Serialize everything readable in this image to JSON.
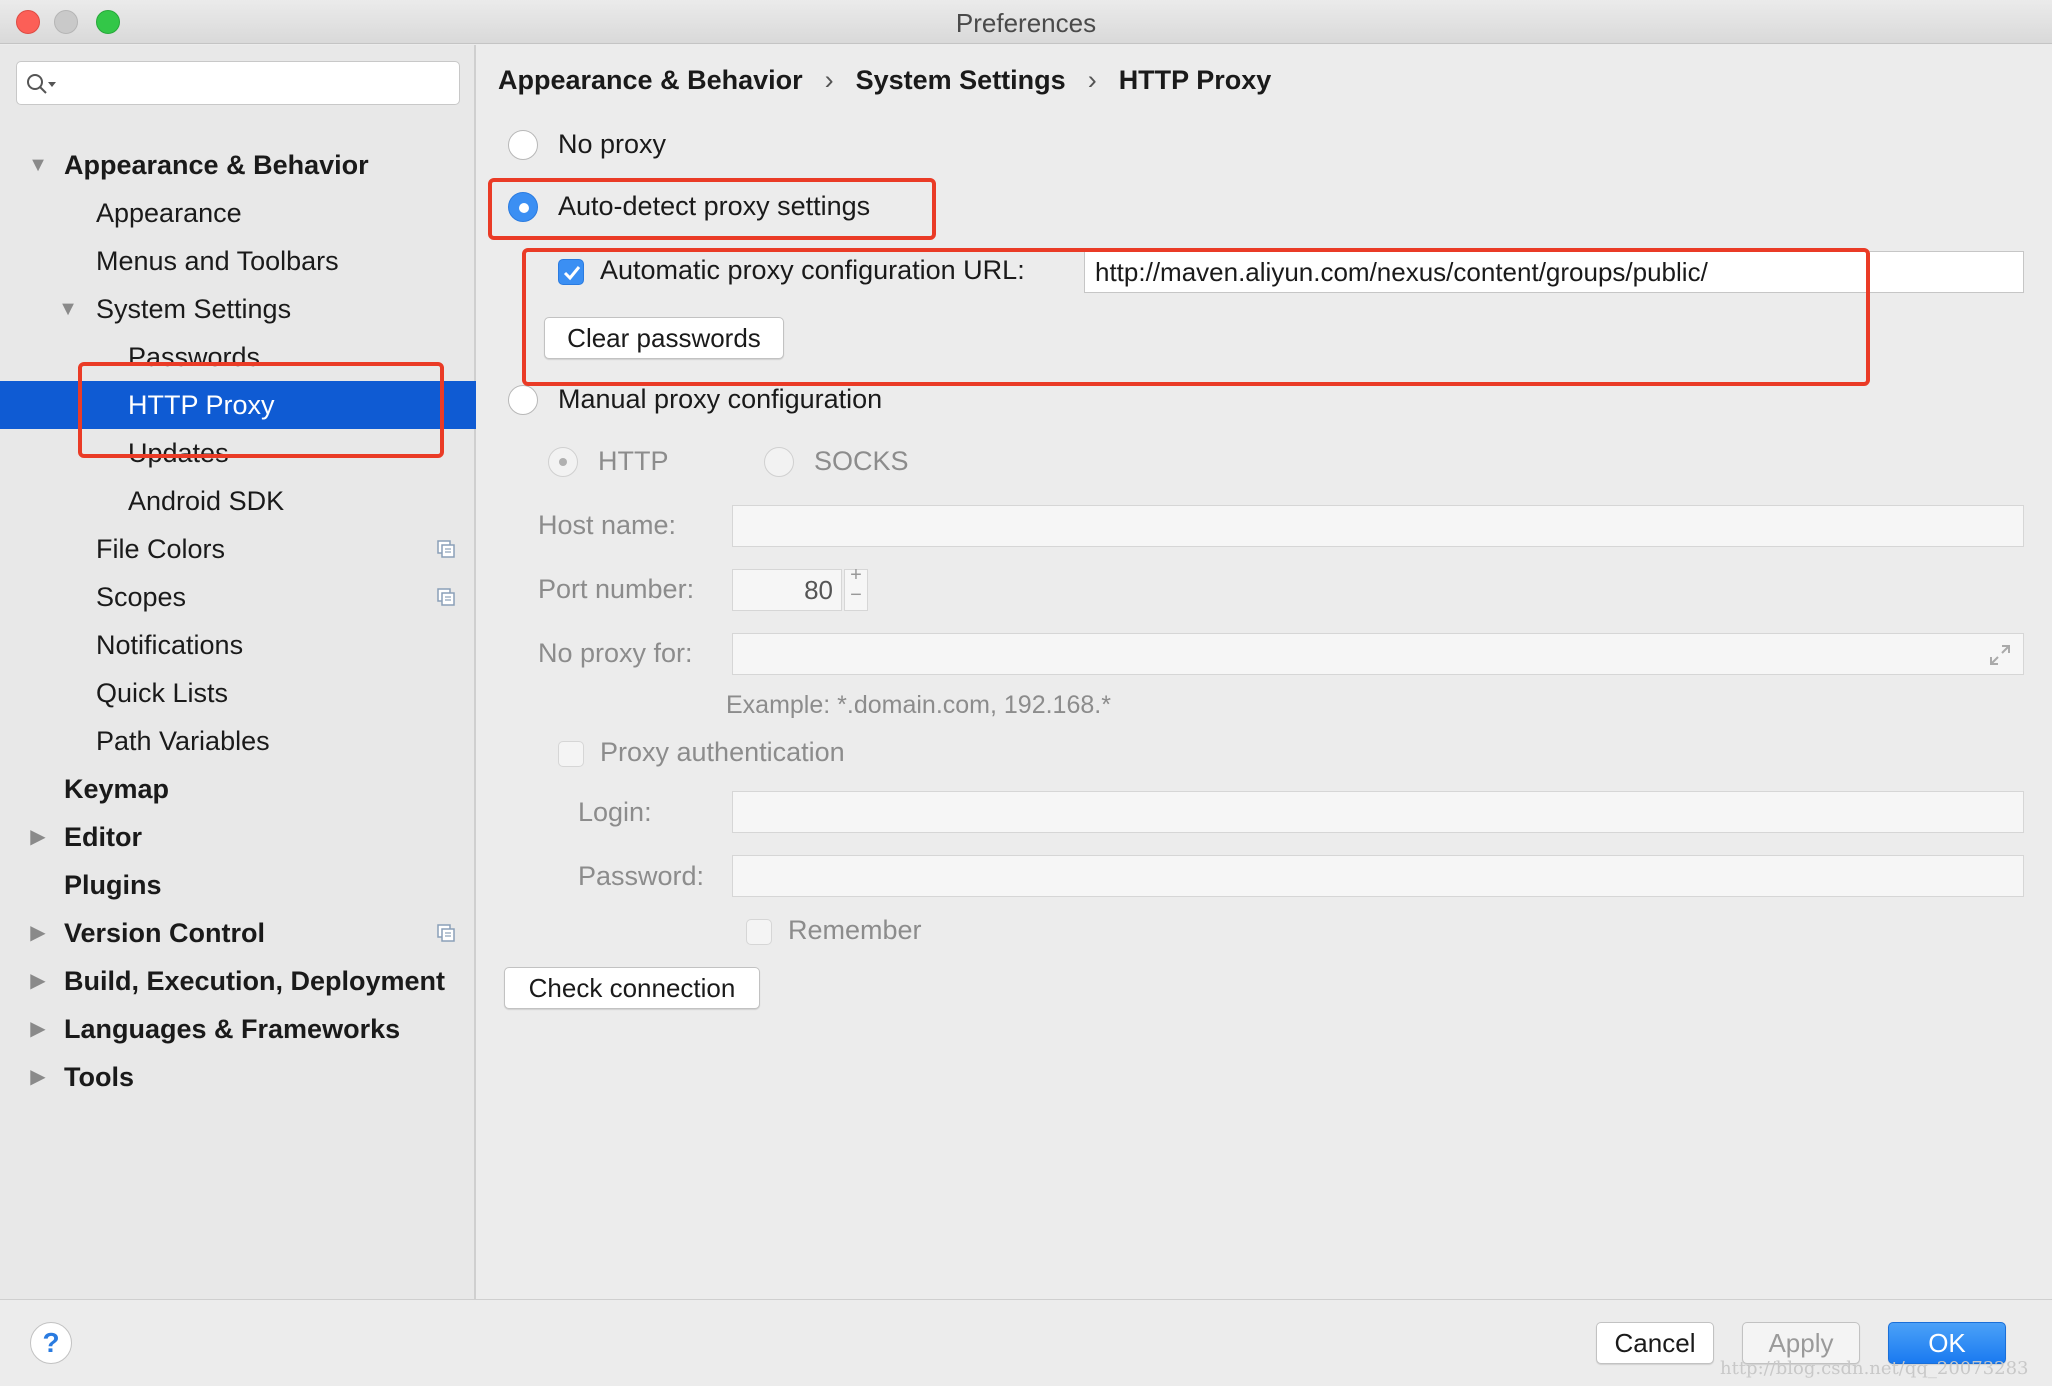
{
  "window": {
    "title": "Preferences"
  },
  "search": {
    "value": "",
    "placeholder": ""
  },
  "sidebar": {
    "items": [
      {
        "label": "Appearance & Behavior"
      },
      {
        "label": "Appearance"
      },
      {
        "label": "Menus and Toolbars"
      },
      {
        "label": "System Settings"
      },
      {
        "label": "Passwords"
      },
      {
        "label": "HTTP Proxy"
      },
      {
        "label": "Updates"
      },
      {
        "label": "Android SDK"
      },
      {
        "label": "File Colors"
      },
      {
        "label": "Scopes"
      },
      {
        "label": "Notifications"
      },
      {
        "label": "Quick Lists"
      },
      {
        "label": "Path Variables"
      },
      {
        "label": "Keymap"
      },
      {
        "label": "Editor"
      },
      {
        "label": "Plugins"
      },
      {
        "label": "Version Control"
      },
      {
        "label": "Build, Execution, Deployment"
      },
      {
        "label": "Languages & Frameworks"
      },
      {
        "label": "Tools"
      }
    ],
    "selected": "HTTP Proxy"
  },
  "breadcrumb": {
    "items": [
      "Appearance & Behavior",
      "System Settings",
      "HTTP Proxy"
    ],
    "separator": "›"
  },
  "proxy": {
    "no_proxy_label": "No proxy",
    "auto_detect_label": "Auto-detect proxy settings",
    "auto_config_url_label": "Automatic proxy configuration URL:",
    "auto_config_url_value": "http://maven.aliyun.com/nexus/content/groups/public/",
    "clear_passwords_label": "Clear passwords",
    "manual_label": "Manual proxy configuration",
    "http_label": "HTTP",
    "socks_label": "SOCKS",
    "host_name_label": "Host name:",
    "host_name_value": "",
    "port_number_label": "Port number:",
    "port_number_value": "80",
    "stepper_plus": "+",
    "stepper_minus": "−",
    "no_proxy_for_label": "No proxy for:",
    "no_proxy_for_value": "",
    "example_text": "Example: *.domain.com, 192.168.*",
    "proxy_auth_label": "Proxy authentication",
    "login_label": "Login:",
    "login_value": "",
    "password_label": "Password:",
    "password_value": "",
    "remember_label": "Remember",
    "check_connection_label": "Check connection",
    "selected_mode": "auto-detect",
    "auto_config_checked": true
  },
  "footer": {
    "help_label": "?",
    "cancel_label": "Cancel",
    "apply_label": "Apply",
    "ok_label": "OK"
  },
  "watermark": "http://blog.csdn.net/qq_20073283",
  "colors": {
    "selection": "#0f5bd3",
    "accent": "#3b8ff3",
    "highlight_annotation": "#ea3b26"
  }
}
